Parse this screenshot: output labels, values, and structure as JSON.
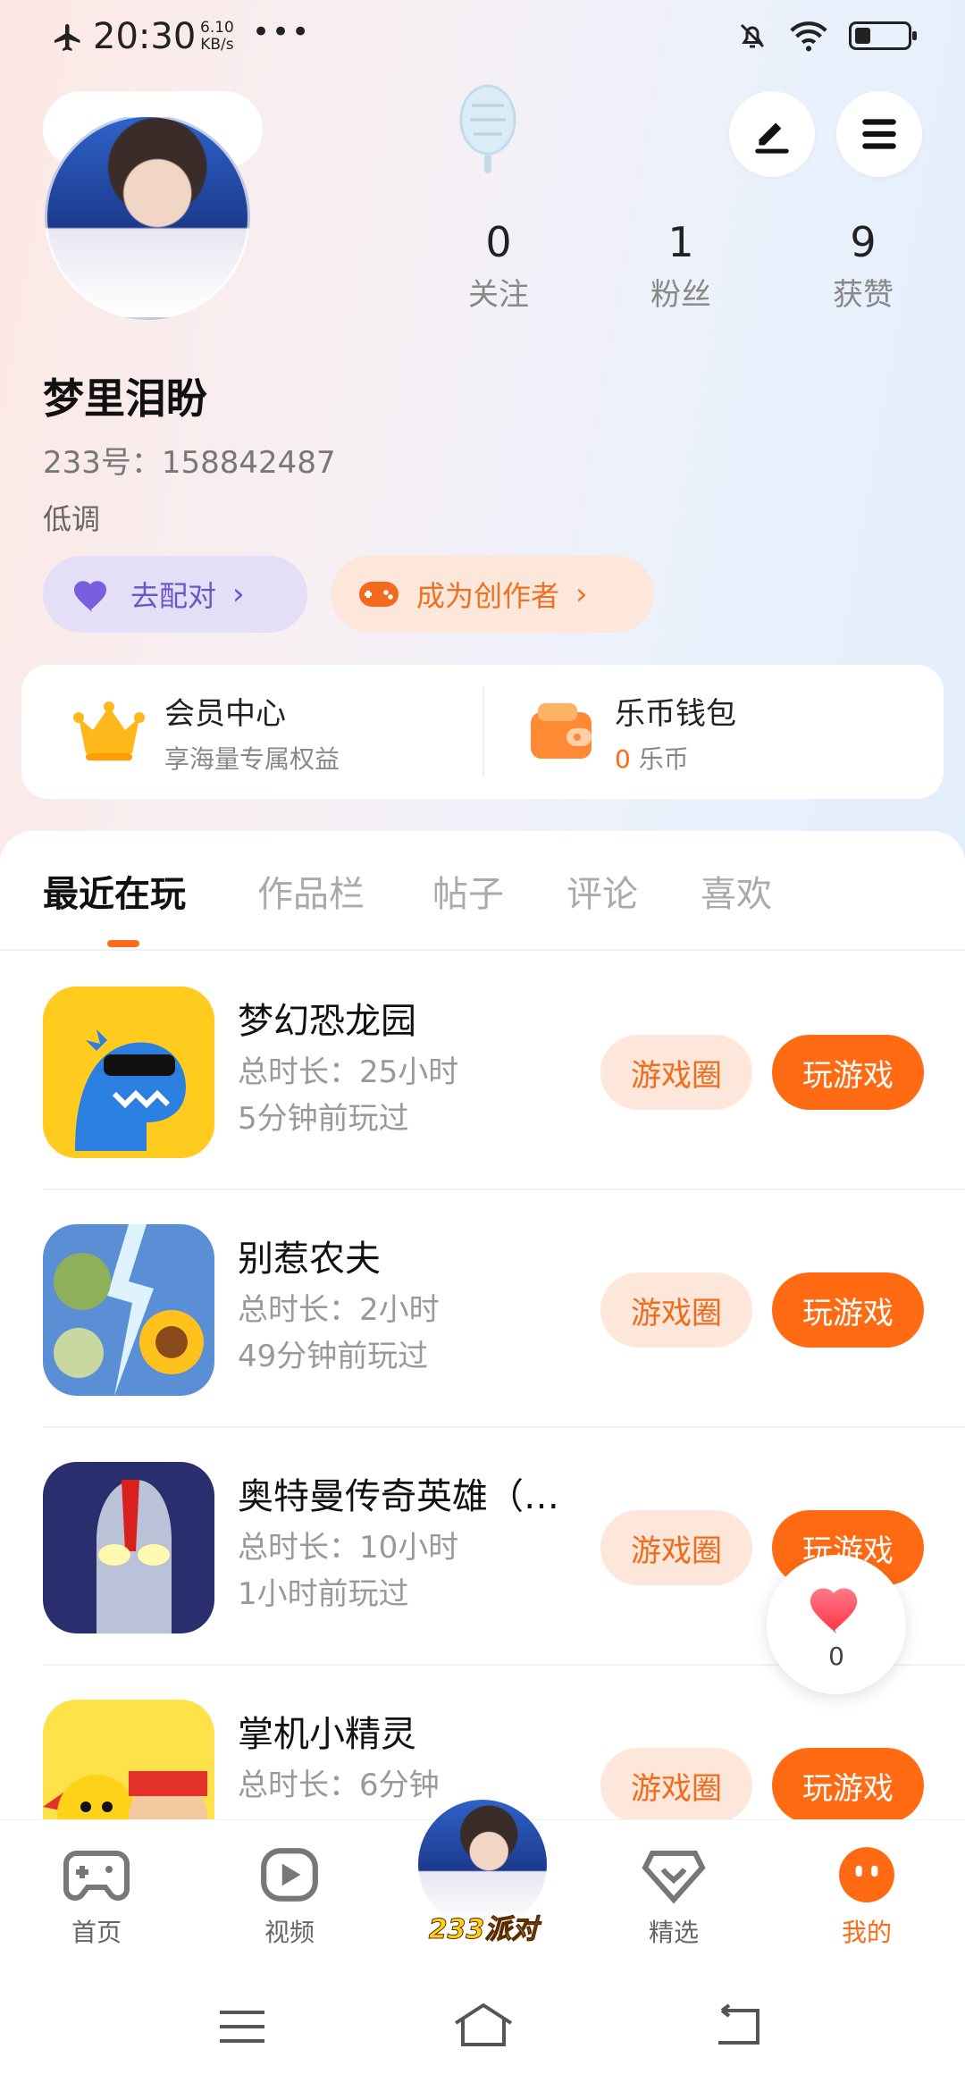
{
  "status_bar": {
    "time": "20:30",
    "speed_value": "6.10",
    "speed_unit": "KB/s",
    "more": "•••"
  },
  "profile": {
    "stats": [
      {
        "value": "0",
        "label": "关注"
      },
      {
        "value": "1",
        "label": "粉丝"
      },
      {
        "value": "9",
        "label": "获赞"
      }
    ],
    "name": "梦里泪盼",
    "id_text": "233号：158842487",
    "signature": "低调",
    "match_chip": "去配对",
    "creator_chip": "成为创作者"
  },
  "vip": {
    "member_title": "会员中心",
    "member_sub": "享海量专属权益",
    "wallet_title": "乐币钱包",
    "wallet_amount": "0",
    "wallet_unit": "乐币"
  },
  "tabs": [
    "最近在玩",
    "作品栏",
    "帖子",
    "评论",
    "喜欢"
  ],
  "games": [
    {
      "name": "梦幻恐龙园",
      "duration": "总时长：25小时",
      "last": "5分钟前玩过",
      "circle": "游戏圈",
      "play": "玩游戏"
    },
    {
      "name": "别惹农夫",
      "duration": "总时长：2小时",
      "last": "49分钟前玩过",
      "circle": "游戏圈",
      "play": "玩游戏"
    },
    {
      "name": "奥特曼传奇英雄（…",
      "duration": "总时长：10小时",
      "last": "1小时前玩过",
      "circle": "游戏圈",
      "play": "玩游戏"
    },
    {
      "name": "掌机小精灵",
      "duration": "总时长：6分钟",
      "last": "",
      "circle": "游戏圈",
      "play": "玩游戏"
    }
  ],
  "like_float": {
    "count": "0"
  },
  "bottom_nav": {
    "home": "首页",
    "video": "视频",
    "center": "233派对",
    "featured": "精选",
    "mine": "我的"
  },
  "colors": {
    "accent": "#ff6a12",
    "accent_light": "#fde7db",
    "match": "#6a55c9"
  }
}
